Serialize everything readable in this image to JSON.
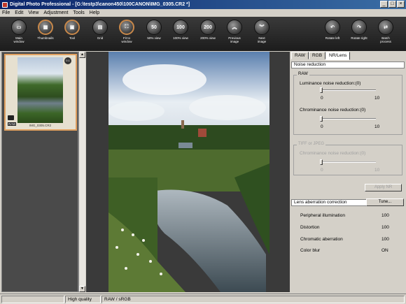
{
  "window": {
    "title": "Digital Photo Professional - [G:\\testp3\\canon450\\100CANON\\IMG_0305.CR2 *]",
    "controls": [
      "_",
      "□",
      "×"
    ]
  },
  "menu": [
    "File",
    "Edit",
    "View",
    "Adjustment",
    "Tools",
    "Help"
  ],
  "toolbar": [
    {
      "label": "Main\nwindow",
      "icon": "folder-icon",
      "glyph": "▭"
    },
    {
      "label": "Thumbnails",
      "icon": "thumbnails-icon",
      "glyph": "▦"
    },
    {
      "label": "Tool",
      "icon": "tool-icon",
      "glyph": "▣"
    },
    {
      "label": "Grid",
      "icon": "grid-icon",
      "glyph": "▤"
    },
    {
      "label": "Fit to\nwindow",
      "icon": "fit-window-icon",
      "glyph": "⛶"
    },
    {
      "label": "50% view",
      "icon": "zoom-50-icon",
      "glyph": "50"
    },
    {
      "label": "100% view",
      "icon": "zoom-100-icon",
      "glyph": "100"
    },
    {
      "label": "200% view",
      "icon": "zoom-200-icon",
      "glyph": "200"
    },
    {
      "label": "Previous\nimage",
      "icon": "previous-image-icon",
      "glyph": "︽"
    },
    {
      "label": "Next\nimage",
      "icon": "next-image-icon",
      "glyph": "︾"
    },
    {
      "label": "Rotate left",
      "icon": "rotate-left-icon",
      "glyph": "↶"
    },
    {
      "label": "Rotate right",
      "icon": "rotate-right-icon",
      "glyph": "↷"
    },
    {
      "label": "Batch\nprocess",
      "icon": "batch-process-icon",
      "glyph": "⇄"
    }
  ],
  "thumbnail": {
    "filename": "IMG_0305.CR2",
    "badge": "0.1",
    "raw_tag": "RAW"
  },
  "tabs": [
    "RAW",
    "RGB",
    "NR/Lens"
  ],
  "active_tab": "NR/Lens",
  "noise_reduction": {
    "header": "Noise reduction",
    "raw_group": "RAW",
    "luminance_label": "Luminance noise reduction:(0)",
    "luminance_min": "0",
    "luminance_max": "10",
    "luminance_value": 0,
    "chrominance_label": "Chrominance noise reduction:(0)",
    "chrominance_min": "0",
    "chrominance_max": "10",
    "chrominance_value": 0,
    "tiff_group": "TIFF or JPEG",
    "tiff_chrominance_label": "Chrominance noise reduction:(0)",
    "tiff_min": "0",
    "tiff_max": "10",
    "apply_button": "Apply NR"
  },
  "lens": {
    "header": "Lens aberration correction",
    "tune_button": "Tune...",
    "rows": [
      {
        "label": "Peripheral illumination",
        "value": "100"
      },
      {
        "label": "Distortion",
        "value": "100"
      },
      {
        "label": "Chromatic aberration",
        "value": "100"
      },
      {
        "label": "Color blur",
        "value": "ON"
      }
    ]
  },
  "status": {
    "quality": "High quality",
    "colorspace": "RAW / sRGB"
  }
}
